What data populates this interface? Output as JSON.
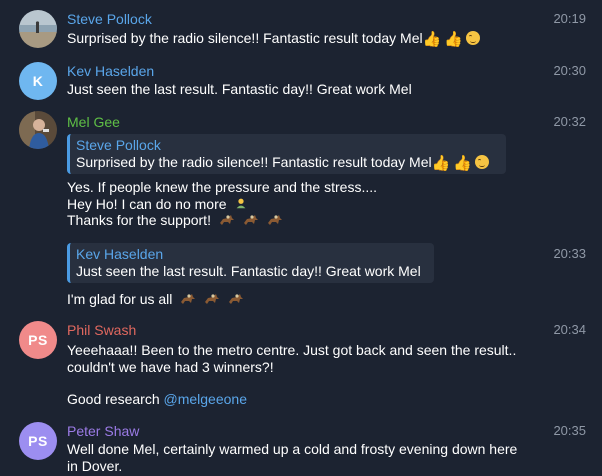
{
  "colors": {
    "background": "#1c2331",
    "name_steve": "#5aa6ea",
    "name_mel": "#5fbf46",
    "name_phil": "#e0685f",
    "name_peter": "#9b7be6",
    "avatar_kev": "#6fb7f0",
    "avatar_phil": "#f08a8a",
    "avatar_peter": "#9c8ef0",
    "timestamp": "#8f98a6",
    "mention": "#5aa6ea"
  },
  "messages": [
    {
      "sender": "Steve Pollock",
      "time": "20:19",
      "avatar": "photo-beach",
      "text": "Surprised by the radio silence!! Fantastic result today Mel",
      "emojis": [
        "thumbs-up-icon",
        "thumbs-up-icon",
        "winking-face-icon"
      ]
    },
    {
      "sender": "Kev Haselden",
      "time": "20:30",
      "avatar_initials": "K",
      "text": "Just seen the last result. Fantastic day!! Great work Mel"
    },
    {
      "sender": "Mel Gee",
      "time": "20:32",
      "avatar": "photo-person",
      "reply": {
        "name": "Steve Pollock",
        "text": "Surprised by the radio silence!! Fantastic result today Mel"
      },
      "lines": [
        "Yes. If people knew the pressure and the stress....",
        "Hey Ho! I can do no more",
        "Thanks for the support!"
      ]
    },
    {
      "time": "20:33",
      "reply": {
        "name": "Kev Haselden",
        "text": "Just seen the last result. Fantastic day!! Great work Mel"
      },
      "text": "I'm glad for us all"
    },
    {
      "sender": "Phil Swash",
      "time": "20:34",
      "avatar_initials": "PS",
      "lines": [
        "Yeeehaaa!! Been to the metro centre. Just got back and seen the result..",
        "couldn't we have had  3 winners?!"
      ],
      "extra_text": "Good research ",
      "mention": "@melgeeone"
    },
    {
      "sender": "Peter Shaw",
      "time": "20:35",
      "avatar_initials": "PS",
      "lines": [
        "Well done Mel, certainly warmed up a cold and frosty evening down here",
        "in Dover."
      ]
    }
  ]
}
